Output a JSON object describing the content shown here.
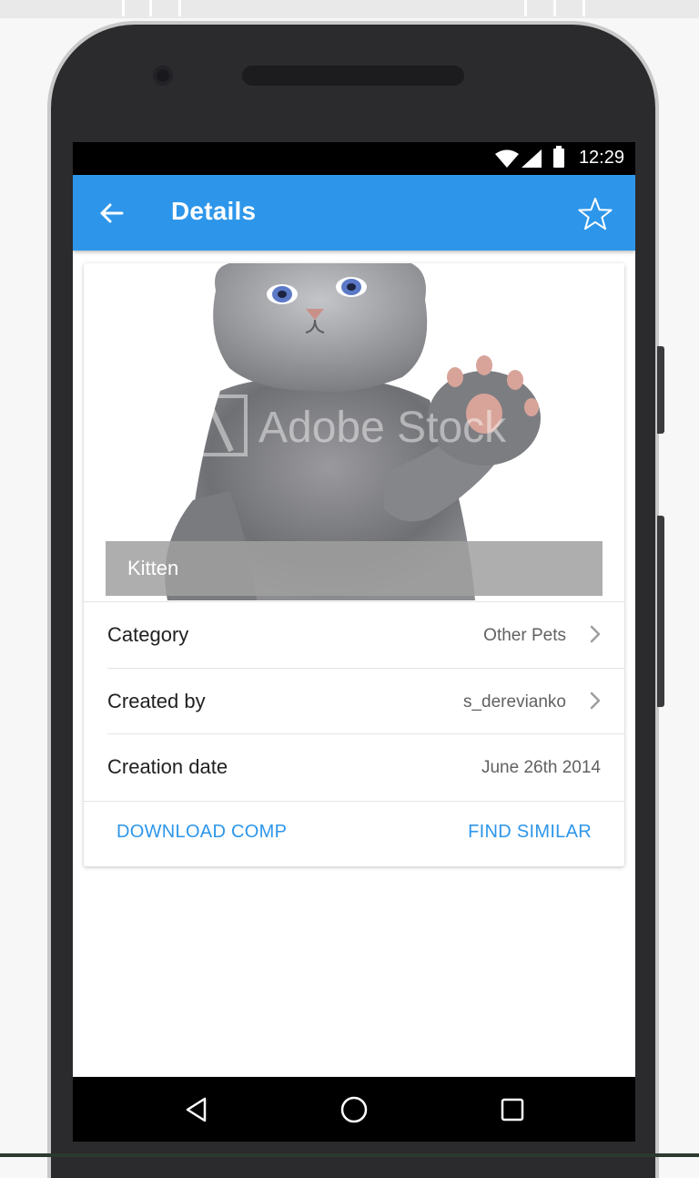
{
  "status_bar": {
    "time": "12:29",
    "icons": [
      "wifi-icon",
      "signal-icon",
      "battery-icon"
    ]
  },
  "app_bar": {
    "title": "Details",
    "back_icon": "arrow-left-icon",
    "favorite_icon": "star-outline-icon",
    "color": "#2d96ea"
  },
  "image": {
    "caption": "Kitten",
    "watermark": "Adobe Stock"
  },
  "details": [
    {
      "label": "Category",
      "value": "Other Pets",
      "chevron": true
    },
    {
      "label": "Created by",
      "value": "s_derevianko",
      "chevron": true
    },
    {
      "label": "Creation date",
      "value": "June 26th 2014",
      "chevron": false
    }
  ],
  "actions": {
    "download": "DOWNLOAD COMP",
    "find_similar": "FIND SIMILAR"
  },
  "nav_bar": {
    "icons": [
      "back-triangle-icon",
      "home-circle-icon",
      "recents-square-icon"
    ]
  }
}
